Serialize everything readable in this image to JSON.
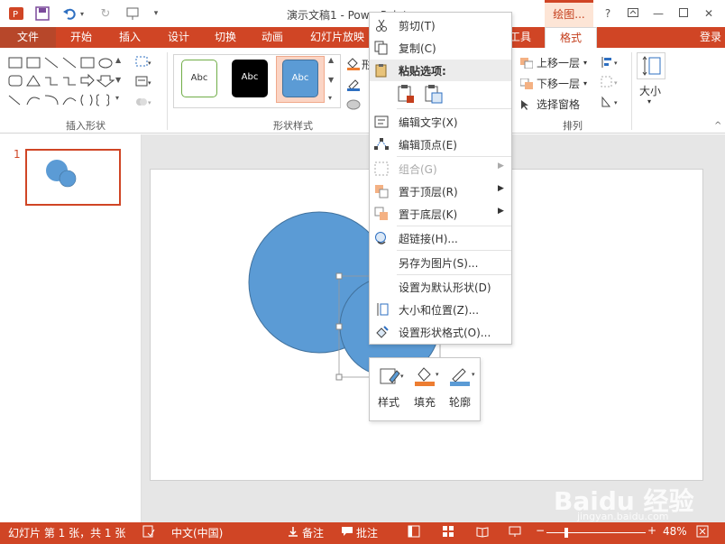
{
  "app": {
    "title": "演示文稿1 - PowerPoint",
    "contextual_tab": "绘图...",
    "login": "登录",
    "brand_color": "#d04525"
  },
  "tabs": [
    "文件",
    "开始",
    "插入",
    "设计",
    "切换",
    "动画",
    "幻灯片放映",
    "工具",
    "格式"
  ],
  "ribbon": {
    "group_insert_shapes": "插入形状",
    "group_shape_styles": "形状样式",
    "group_arrange": "排列",
    "style_samples": [
      "Abc",
      "Abc",
      "Abc"
    ],
    "arrange": {
      "bring_forward": "上移一层",
      "send_backward": "下移一层",
      "selection_pane": "选择窗格"
    },
    "size_label": "大小",
    "shape_fill_partial": "形"
  },
  "slides_panel": {
    "slide_number": "1"
  },
  "context_menu": {
    "cut": "剪切(T)",
    "copy": "复制(C)",
    "paste_options": "粘贴选项:",
    "edit_text": "编辑文字(X)",
    "edit_points": "编辑顶点(E)",
    "group": "组合(G)",
    "bring_to_front": "置于顶层(R)",
    "send_to_back": "置于底层(K)",
    "hyperlink": "超链接(H)...",
    "save_as_picture": "另存为图片(S)...",
    "set_default_shape": "设置为默认形状(D)",
    "size_position": "大小和位置(Z)...",
    "format_shape": "设置形状格式(O)..."
  },
  "mini_toolbar": {
    "style": "样式",
    "fill": "填充",
    "outline": "轮廓"
  },
  "status": {
    "slide_info": "幻灯片 第 1 张，共 1 张",
    "language": "中文(中国)",
    "notes": "备注",
    "comments": "批注",
    "zoom": "48%"
  },
  "watermark": {
    "line1": "Baidu 经验",
    "line2": "jingyan.baidu.com"
  },
  "colors": {
    "shape_fill": "#5b9bd5",
    "shape_stroke": "#41719c",
    "selected_style_bg": "#fbd4c4"
  }
}
